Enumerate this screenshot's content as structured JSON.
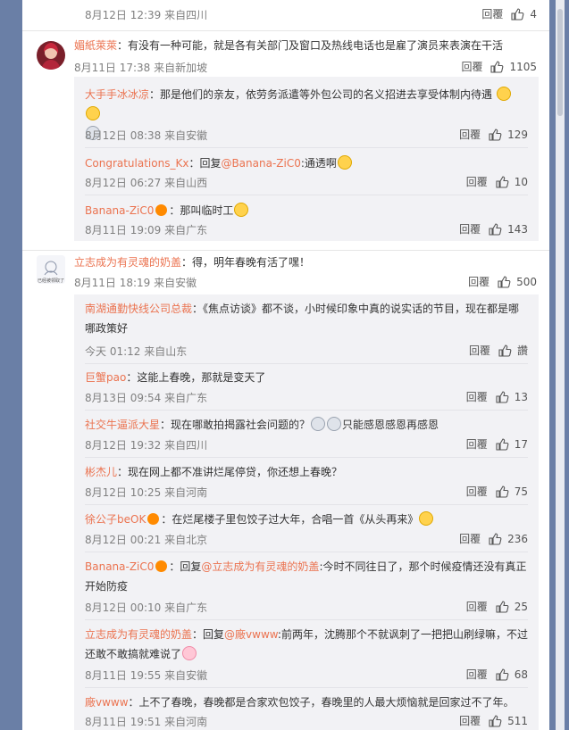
{
  "top": {
    "meta": "8月12日 12:39 来自四川",
    "reply": "回覆",
    "likes": "4"
  },
  "c1": {
    "name": "媚紙萊萊",
    "text": "：有没有一种可能，就是各有关部门及窗口及热线电话也是雇了演员来表演在干活",
    "meta": "8月11日 17:38 来自新加坡",
    "reply": "回覆",
    "likes": "1105",
    "replies": [
      {
        "name": "大手手冰冰凉",
        "text": "：那是他们的亲友，依劳务派遣等外包公司的名义招进去享受体制内待遇",
        "meta": "8月12日 08:38 来自安徽",
        "reply": "回覆",
        "likes": "129"
      },
      {
        "name": "Congratulations_Kx",
        "text_prefix": "：回复",
        "mention": "@Banana-ZiC0",
        "text": ":通透啊",
        "meta": "8月12日 06:27 来自山西",
        "reply": "回覆",
        "likes": "10"
      },
      {
        "name": "Banana-ZiC0",
        "text": "：那叫临时工",
        "meta": "8月11日 19:09 来自广东",
        "reply": "回覆",
        "likes": "143"
      }
    ]
  },
  "c2": {
    "name": "立志成为有灵魂的奶盖",
    "text": "：得，明年春晚有活了嘿！",
    "meta": "8月11日 18:19 来自安徽",
    "reply": "回覆",
    "likes": "500",
    "avatar_caption": "已经被领取了",
    "replies": [
      {
        "name": "南湖通勤快线公司总裁",
        "text": "：《焦点访谈》都不谈，小时候印象中真的说实话的节目，现在都是哪哪政策好",
        "meta": "今天 01:12 来自山东",
        "reply": "回覆",
        "likes": "讚"
      },
      {
        "name": "巨蟹pao",
        "text": "：这能上春晚，那就是变天了",
        "meta": "8月13日 09:54 来自广东",
        "reply": "回覆",
        "likes": "13"
      },
      {
        "name": "社交牛逼派大星",
        "text": "：现在哪敢拍揭露社会问题的？",
        "text_suffix": "只能感恩感恩再感恩",
        "meta": "8月12日 19:32 来自四川",
        "reply": "回覆",
        "likes": "17"
      },
      {
        "name": "彬杰儿",
        "text": "：现在网上都不准讲烂尾停贷，你还想上春晚？",
        "meta": "8月12日 10:25 来自河南",
        "reply": "回覆",
        "likes": "75"
      },
      {
        "name": "徐公子beOK",
        "text": "：在烂尾楼子里包饺子过大年，合唱一首《从头再来》",
        "meta": "8月12日 00:21 来自北京",
        "reply": "回覆",
        "likes": "236"
      },
      {
        "name": "Banana-ZiC0",
        "text_prefix": "：回复",
        "mention": "@立志成为有灵魂的奶盖",
        "text": ":今时不同往日了，那个时候疫情还没有真正开始防疫",
        "meta": "8月12日 00:10 来自广东",
        "reply": "回覆",
        "likes": "25"
      },
      {
        "name": "立志成为有灵魂的奶盖",
        "text_prefix": "：回复",
        "mention": "@廠vwww",
        "text": ":前两年，沈腾那个不就讽刺了一把把山刷绿嘛，不过还敢不敢搞就难说了",
        "meta": "8月11日 19:55 来自安徽",
        "reply": "回覆",
        "likes": "68"
      },
      {
        "name": "廠vwww",
        "text": "：上不了春晚，春晚都是合家欢包饺子，春晚里的人最大烦恼就是回家过不了年。",
        "meta": "8月11日 19:51 来自河南",
        "reply": "回覆",
        "likes": "511"
      }
    ]
  },
  "colors": {
    "accent": "#eb7350",
    "background": "#6a7fa6",
    "reply_bg": "#f2f2f5"
  },
  "icons": {
    "like": "thumbs-up-icon"
  }
}
